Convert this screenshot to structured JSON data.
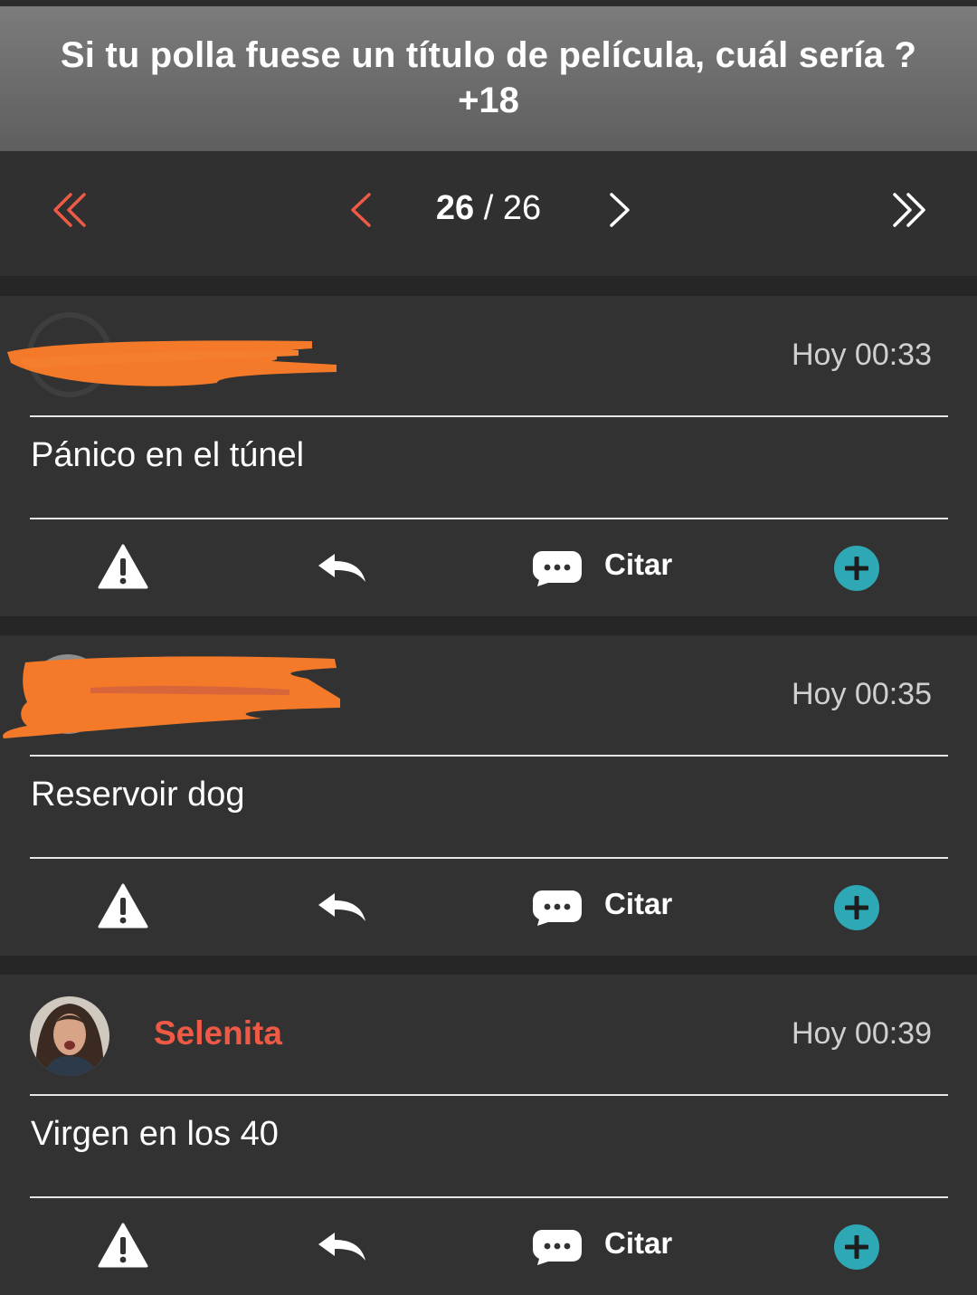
{
  "thread": {
    "title_line1": "Si tu polla fuese un título de película, cuál sería ?",
    "title_line2": "+18"
  },
  "pager": {
    "current": "26",
    "separator": " / ",
    "total": "26",
    "icons": [
      "first-page-icon",
      "prev-page-icon",
      "next-page-icon",
      "last-page-icon"
    ]
  },
  "posts": [
    {
      "username": "",
      "username_redacted": true,
      "time": "Hoy 00:33",
      "body": "Pánico en el túnel",
      "actions": {
        "report_icon": "warning-icon",
        "reply_icon": "reply-icon",
        "quote_icon": "chat-bubble-icon",
        "quote_label": "Citar",
        "more_icon": "plus-circle-icon"
      }
    },
    {
      "username": "",
      "username_redacted": true,
      "time": "Hoy 00:35",
      "body": "Reservoir dog",
      "actions": {
        "report_icon": "warning-icon",
        "reply_icon": "reply-icon",
        "quote_icon": "chat-bubble-icon",
        "quote_label": "Citar",
        "more_icon": "plus-circle-icon"
      }
    },
    {
      "username": "Selenita",
      "username_redacted": false,
      "time": "Hoy 00:39",
      "body": "Virgen en los 40",
      "actions": {
        "report_icon": "warning-icon",
        "reply_icon": "reply-icon",
        "quote_icon": "chat-bubble-icon",
        "quote_label": "Citar",
        "more_icon": "plus-circle-icon"
      }
    }
  ],
  "colors": {
    "accent_red": "#ee5a45",
    "accent_teal": "#2fa8b5",
    "redaction_orange": "#f47a2a",
    "header_gray": "#6e6e6e",
    "card_bg": "#323232"
  }
}
